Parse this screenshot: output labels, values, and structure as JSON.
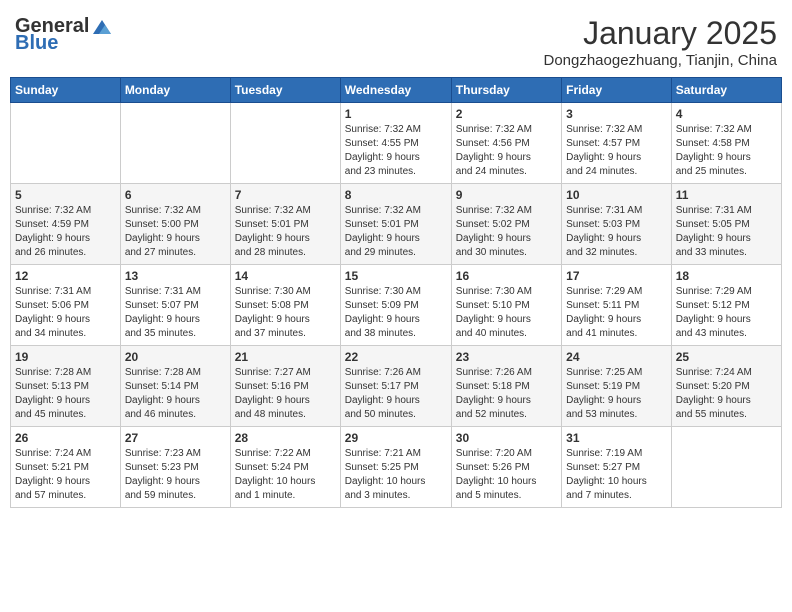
{
  "logo": {
    "general": "General",
    "blue": "Blue"
  },
  "header": {
    "month": "January 2025",
    "location": "Dongzhaogezhuang, Tianjin, China"
  },
  "weekdays": [
    "Sunday",
    "Monday",
    "Tuesday",
    "Wednesday",
    "Thursday",
    "Friday",
    "Saturday"
  ],
  "weeks": [
    [
      {
        "day": "",
        "info": ""
      },
      {
        "day": "",
        "info": ""
      },
      {
        "day": "",
        "info": ""
      },
      {
        "day": "1",
        "info": "Sunrise: 7:32 AM\nSunset: 4:55 PM\nDaylight: 9 hours\nand 23 minutes."
      },
      {
        "day": "2",
        "info": "Sunrise: 7:32 AM\nSunset: 4:56 PM\nDaylight: 9 hours\nand 24 minutes."
      },
      {
        "day": "3",
        "info": "Sunrise: 7:32 AM\nSunset: 4:57 PM\nDaylight: 9 hours\nand 24 minutes."
      },
      {
        "day": "4",
        "info": "Sunrise: 7:32 AM\nSunset: 4:58 PM\nDaylight: 9 hours\nand 25 minutes."
      }
    ],
    [
      {
        "day": "5",
        "info": "Sunrise: 7:32 AM\nSunset: 4:59 PM\nDaylight: 9 hours\nand 26 minutes."
      },
      {
        "day": "6",
        "info": "Sunrise: 7:32 AM\nSunset: 5:00 PM\nDaylight: 9 hours\nand 27 minutes."
      },
      {
        "day": "7",
        "info": "Sunrise: 7:32 AM\nSunset: 5:01 PM\nDaylight: 9 hours\nand 28 minutes."
      },
      {
        "day": "8",
        "info": "Sunrise: 7:32 AM\nSunset: 5:01 PM\nDaylight: 9 hours\nand 29 minutes."
      },
      {
        "day": "9",
        "info": "Sunrise: 7:32 AM\nSunset: 5:02 PM\nDaylight: 9 hours\nand 30 minutes."
      },
      {
        "day": "10",
        "info": "Sunrise: 7:31 AM\nSunset: 5:03 PM\nDaylight: 9 hours\nand 32 minutes."
      },
      {
        "day": "11",
        "info": "Sunrise: 7:31 AM\nSunset: 5:05 PM\nDaylight: 9 hours\nand 33 minutes."
      }
    ],
    [
      {
        "day": "12",
        "info": "Sunrise: 7:31 AM\nSunset: 5:06 PM\nDaylight: 9 hours\nand 34 minutes."
      },
      {
        "day": "13",
        "info": "Sunrise: 7:31 AM\nSunset: 5:07 PM\nDaylight: 9 hours\nand 35 minutes."
      },
      {
        "day": "14",
        "info": "Sunrise: 7:30 AM\nSunset: 5:08 PM\nDaylight: 9 hours\nand 37 minutes."
      },
      {
        "day": "15",
        "info": "Sunrise: 7:30 AM\nSunset: 5:09 PM\nDaylight: 9 hours\nand 38 minutes."
      },
      {
        "day": "16",
        "info": "Sunrise: 7:30 AM\nSunset: 5:10 PM\nDaylight: 9 hours\nand 40 minutes."
      },
      {
        "day": "17",
        "info": "Sunrise: 7:29 AM\nSunset: 5:11 PM\nDaylight: 9 hours\nand 41 minutes."
      },
      {
        "day": "18",
        "info": "Sunrise: 7:29 AM\nSunset: 5:12 PM\nDaylight: 9 hours\nand 43 minutes."
      }
    ],
    [
      {
        "day": "19",
        "info": "Sunrise: 7:28 AM\nSunset: 5:13 PM\nDaylight: 9 hours\nand 45 minutes."
      },
      {
        "day": "20",
        "info": "Sunrise: 7:28 AM\nSunset: 5:14 PM\nDaylight: 9 hours\nand 46 minutes."
      },
      {
        "day": "21",
        "info": "Sunrise: 7:27 AM\nSunset: 5:16 PM\nDaylight: 9 hours\nand 48 minutes."
      },
      {
        "day": "22",
        "info": "Sunrise: 7:26 AM\nSunset: 5:17 PM\nDaylight: 9 hours\nand 50 minutes."
      },
      {
        "day": "23",
        "info": "Sunrise: 7:26 AM\nSunset: 5:18 PM\nDaylight: 9 hours\nand 52 minutes."
      },
      {
        "day": "24",
        "info": "Sunrise: 7:25 AM\nSunset: 5:19 PM\nDaylight: 9 hours\nand 53 minutes."
      },
      {
        "day": "25",
        "info": "Sunrise: 7:24 AM\nSunset: 5:20 PM\nDaylight: 9 hours\nand 55 minutes."
      }
    ],
    [
      {
        "day": "26",
        "info": "Sunrise: 7:24 AM\nSunset: 5:21 PM\nDaylight: 9 hours\nand 57 minutes."
      },
      {
        "day": "27",
        "info": "Sunrise: 7:23 AM\nSunset: 5:23 PM\nDaylight: 9 hours\nand 59 minutes."
      },
      {
        "day": "28",
        "info": "Sunrise: 7:22 AM\nSunset: 5:24 PM\nDaylight: 10 hours\nand 1 minute."
      },
      {
        "day": "29",
        "info": "Sunrise: 7:21 AM\nSunset: 5:25 PM\nDaylight: 10 hours\nand 3 minutes."
      },
      {
        "day": "30",
        "info": "Sunrise: 7:20 AM\nSunset: 5:26 PM\nDaylight: 10 hours\nand 5 minutes."
      },
      {
        "day": "31",
        "info": "Sunrise: 7:19 AM\nSunset: 5:27 PM\nDaylight: 10 hours\nand 7 minutes."
      },
      {
        "day": "",
        "info": ""
      }
    ]
  ]
}
